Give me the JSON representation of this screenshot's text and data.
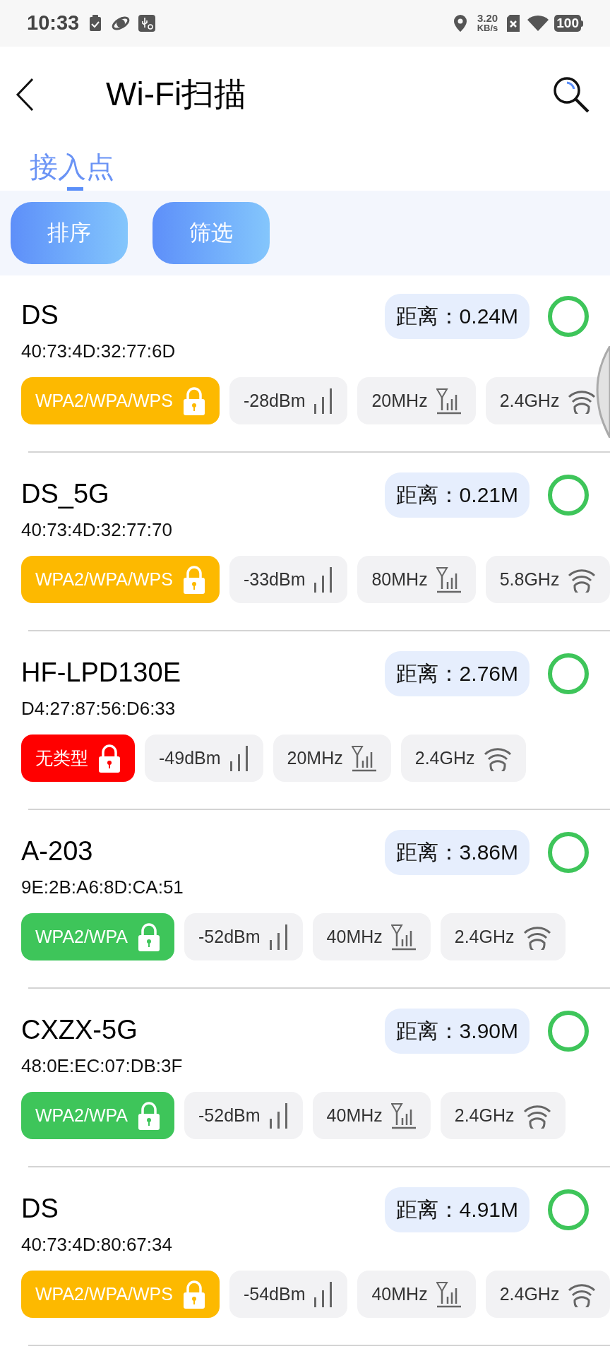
{
  "status_bar": {
    "time": "10:33",
    "speed_value": "3.20",
    "speed_unit": "KB/s",
    "battery": "100"
  },
  "header": {
    "title": "Wi-Fi扫描"
  },
  "tabs": [
    {
      "label": "接入点",
      "selected": true
    }
  ],
  "buttons": [
    "排序",
    "筛选"
  ],
  "networks": [
    {
      "ssid": "DS",
      "mac": "40:73:4D:32:77:6D",
      "distance": "距离：0.24M",
      "security": "WPA2/WPA/WPS",
      "color": "#fdb900",
      "signal": "-28dBm",
      "width": "20MHz",
      "band": "2.4GHz"
    },
    {
      "ssid": "DS_5G",
      "mac": "40:73:4D:32:77:70",
      "distance": "距离：0.21M",
      "security": "WPA2/WPA/WPS",
      "color": "#fdb900",
      "signal": "-33dBm",
      "width": "80MHz",
      "band": "5.8GHz"
    },
    {
      "ssid": "HF-LPD130E",
      "mac": "D4:27:87:56:D6:33",
      "distance": "距离：2.76M",
      "security": "无类型",
      "color": "#ff0000",
      "signal": "-49dBm",
      "width": "20MHz",
      "band": "2.4GHz"
    },
    {
      "ssid": "A-203",
      "mac": "9E:2B:A6:8D:CA:51",
      "distance": "距离：3.86M",
      "security": "WPA2/WPA",
      "color": "#3ec55a",
      "signal": "-52dBm",
      "width": "40MHz",
      "band": "2.4GHz"
    },
    {
      "ssid": "CXZX-5G",
      "mac": "48:0E:EC:07:DB:3F",
      "distance": "距离：3.90M",
      "security": "WPA2/WPA",
      "color": "#3ec55a",
      "signal": "-52dBm",
      "width": "40MHz",
      "band": "2.4GHz"
    },
    {
      "ssid": "DS",
      "mac": "40:73:4D:80:67:34",
      "distance": "距离：4.91M",
      "security": "WPA2/WPA/WPS",
      "color": "#fdb900",
      "signal": "-54dBm",
      "width": "40MHz",
      "band": "2.4GHz"
    }
  ]
}
